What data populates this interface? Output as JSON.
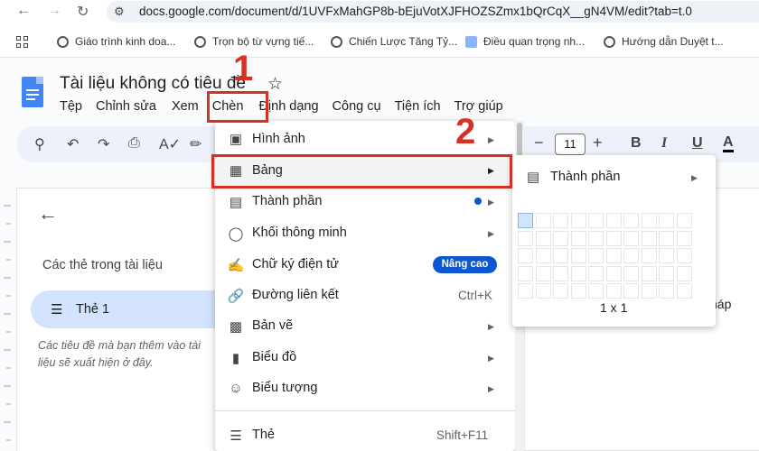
{
  "browser": {
    "url": "docs.google.com/document/d/1UVFxMahGP8b-bEjuVotXJFHOZSZmx1bQrCqX__gN4VM/edit?tab=t.0",
    "back_icon": "arrow-left-icon",
    "forward_icon": "arrow-right-icon",
    "reload_icon": "reload-icon",
    "bookmarks": [
      "Giáo trình kinh doa...",
      "Trọn bộ từ vựng tiế...",
      "Chiến Lược Tăng Tỷ...",
      "Điều quan trọng nh...",
      "Hướng dẫn Duyệt t..."
    ]
  },
  "doc": {
    "title": "Tài liệu không có tiêu đề",
    "menu": [
      "Tệp",
      "Chỉnh sửa",
      "Xem",
      "Chèn",
      "Định dạng",
      "Công cụ",
      "Tiện ích",
      "Trợ giúp"
    ],
    "font_size": "11",
    "toolbar_minus": "−",
    "toolbar_plus": "+",
    "bold": "B",
    "italic": "I",
    "underline": "U",
    "text_color": "A"
  },
  "side_panel": {
    "title": "Các thẻ trong tài liệu",
    "tab_label": "Thẻ 1",
    "hint": "Các tiêu đề mà bạn thêm vào tài liệu sẽ xuất hiện ở đây."
  },
  "page_text": "háp",
  "insert_menu": {
    "items": [
      {
        "label": "Hình ảnh",
        "icon": "image-icon",
        "arrow": "▶"
      },
      {
        "label": "Bảng",
        "icon": "table-icon",
        "arrow": "▶"
      },
      {
        "label": "Thành phần",
        "icon": "building-blocks-icon",
        "arrow": "▶"
      },
      {
        "label": "Khối thông minh",
        "icon": "smart-chips-icon",
        "arrow": "▶"
      },
      {
        "label": "Chữ ký điện tử",
        "icon": "esignature-icon",
        "badge": "Nâng cao"
      },
      {
        "label": "Đường liên kết",
        "icon": "link-icon",
        "shortcut": "Ctrl+K"
      },
      {
        "label": "Bản vẽ",
        "icon": "drawing-icon",
        "arrow": "▶"
      },
      {
        "label": "Biểu đồ",
        "icon": "chart-icon",
        "arrow": "▶"
      },
      {
        "label": "Biểu tượng",
        "icon": "emoji-icon",
        "arrow": "▶"
      },
      {
        "label": "Thẻ",
        "icon": "tab-icon",
        "shortcut": "Shift+F11"
      }
    ]
  },
  "table_submenu": {
    "label": "Thành phần",
    "arrow": "▶",
    "grid_size": "1 x 1",
    "grid_cols": 10,
    "grid_rows": 5
  },
  "annotations": {
    "step1": "1",
    "step2": "2",
    "color": "#d93025"
  }
}
